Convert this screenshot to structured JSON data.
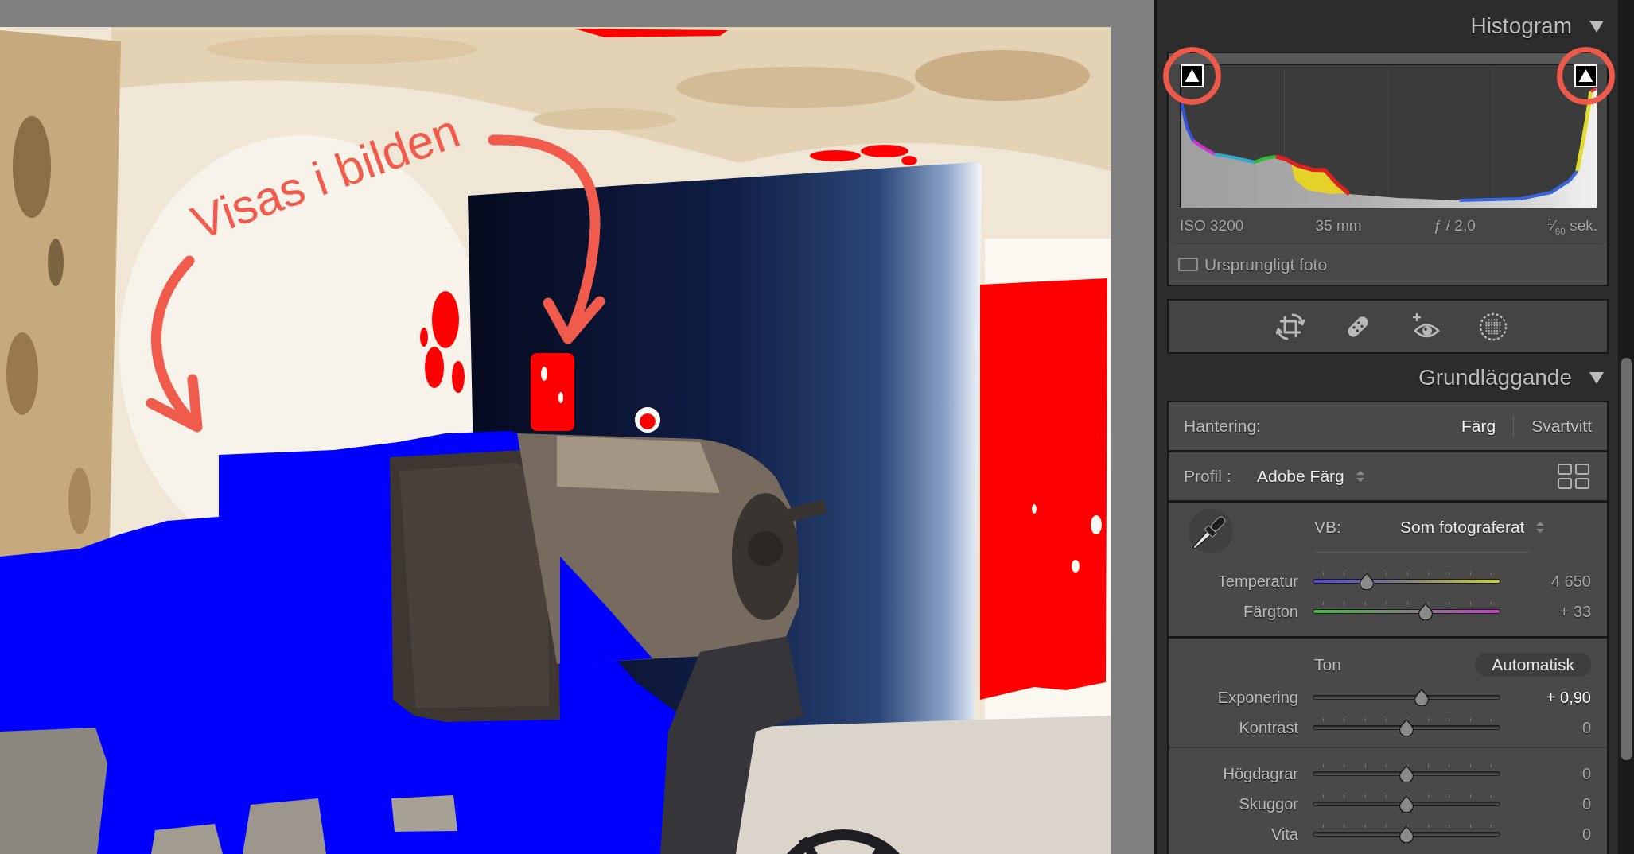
{
  "photo": {
    "annotation": "Visas i bilden"
  },
  "histogram": {
    "title": "Histogram",
    "expanded": true,
    "clipping": {
      "shadows": {
        "on": true,
        "circled": true
      },
      "highlights": {
        "on": true,
        "circled": true
      }
    },
    "exif": [
      "ISO 3200",
      "35 mm",
      "ƒ / 2,0",
      "$^{1}$⁄$_{60}$ sek."
    ],
    "original_photo": {
      "label": "Ursprungligt foto",
      "checked": false
    }
  },
  "basic": {
    "title": "Grundläggande",
    "expanded": true,
    "treatment": {
      "label": "Hantering:",
      "options": [
        {
          "label": "Färg",
          "selected": true
        },
        {
          "label": "Svartvitt",
          "selected": false
        }
      ]
    },
    "profile": {
      "label": "Profil :",
      "value": "Adobe Färg"
    },
    "white_balance": {
      "label": "VB:",
      "value": "Som fotograferat",
      "sliders": [
        {
          "kind": "temperature",
          "label": "Temperatur",
          "level": 0.29,
          "value": "4 650",
          "active": false
        },
        {
          "kind": "tint",
          "label": "Färgton",
          "level": 0.6,
          "value": "+ 33",
          "active": false
        }
      ]
    },
    "tone": {
      "label": "Ton",
      "auto_button": "Automatisk",
      "groups": [
        {
          "sliders": [
            {
              "kind": "plain",
              "label": "Exponering",
              "level": 0.58,
              "value": "+ 0,90",
              "active": true
            },
            {
              "kind": "plain",
              "label": "Kontrast",
              "level": 0.5,
              "value": "0",
              "active": false
            }
          ]
        },
        {
          "sliders": [
            {
              "kind": "plain",
              "label": "Högdagrar",
              "level": 0.5,
              "value": "0",
              "active": false
            },
            {
              "kind": "plain",
              "label": "Skuggor",
              "level": 0.5,
              "value": "0",
              "active": false
            },
            {
              "kind": "plain",
              "label": "Vita",
              "level": 0.5,
              "value": "0",
              "active": false
            }
          ]
        }
      ]
    }
  }
}
